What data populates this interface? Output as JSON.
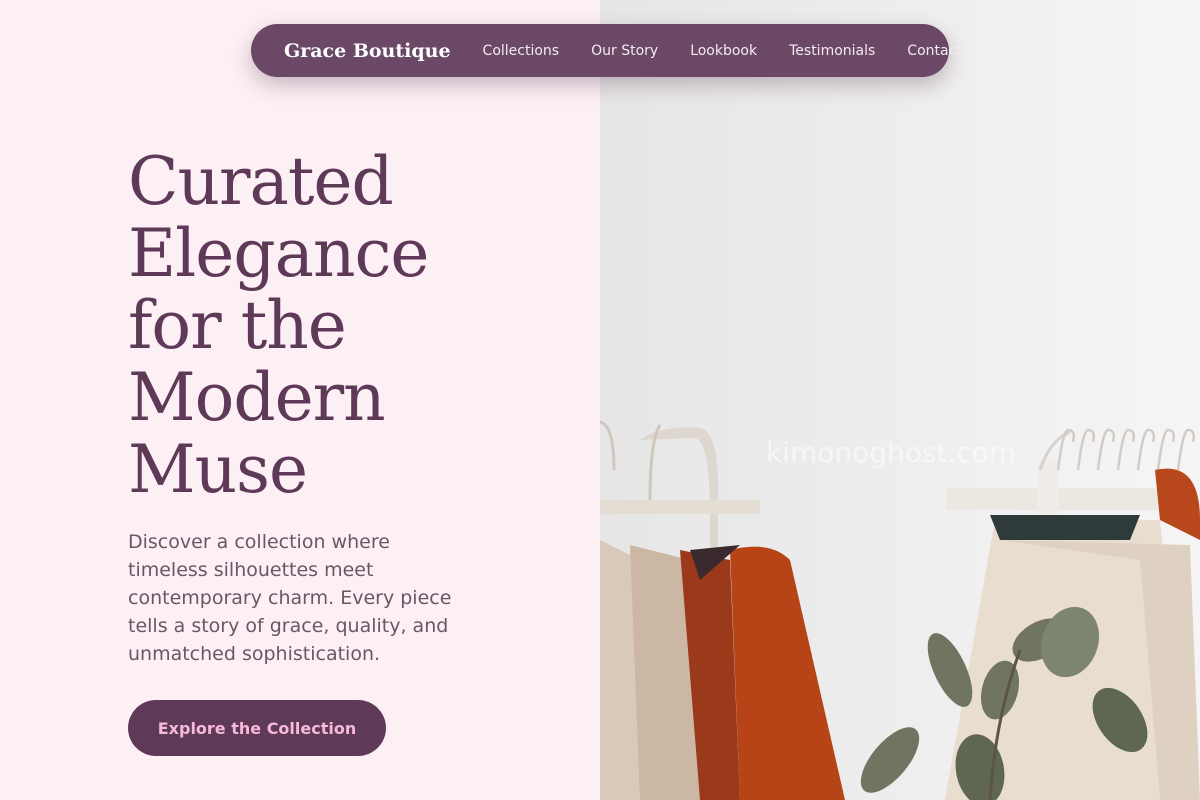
{
  "nav": {
    "brand": "Grace Boutique",
    "links": [
      "Collections",
      "Our Story",
      "Lookbook",
      "Testimonials",
      "Contact"
    ]
  },
  "hero": {
    "title_lines": [
      "Curated",
      "Elegance",
      "for the",
      "Modern",
      "Muse"
    ],
    "description": "Discover a collection where timeless silhouettes meet contemporary charm. Every piece tells a story of grace, quality, and unmatched sophistication.",
    "cta_label": "Explore the Collection"
  },
  "image": {
    "subject": "clothing-racks-with-plant",
    "watermark": "kimonoghost.com"
  },
  "colors": {
    "background": "#fdf0f5",
    "nav_background": "#6b4865",
    "title": "#5e3a58",
    "body_text": "#6c5566",
    "cta_background": "#5e3a58",
    "cta_text": "#f7b9d8"
  }
}
